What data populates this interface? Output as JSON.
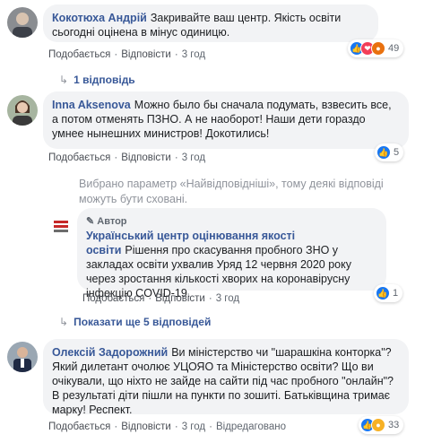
{
  "comments": [
    {
      "author": "Кокотюха Андрій",
      "text": "Закривайте ваш центр. Якість освіти сьогодні оцінена в мінус одиницю.",
      "like_label": "Подобається",
      "reply_label": "Відповісти",
      "time": "3 год",
      "reaction_count": "49",
      "replies_label": "1 відповідь"
    },
    {
      "author": "Inna Aksenova",
      "text": "Можно было бы сначала подумать, взвесить все, а потом отменять ПЗНО. А не наоборот! Наши дети гораздо умнее нынешних министров! Докотились!",
      "like_label": "Подобається",
      "reply_label": "Відповісти",
      "time": "3 год",
      "reaction_count": "5"
    },
    {
      "author": "Олексій Задорожний",
      "text": "Ви міністерство чи \"шарашкіна конторка\"? Який дилетант очолює УЦОЯО та Міністерство освіти? Що ви очікували, що ніхто не зайде на сайти під час пробного \"онлайн\"? В результаті діти пішли на пункти по зошиті. Батьківщина тримає марку! Респект.",
      "like_label": "Подобається",
      "reply_label": "Відповісти",
      "time": "3 год",
      "edited_label": "Відредаговано",
      "reaction_count": "33"
    }
  ],
  "filter_notice": "Вибрано параметр «Найвідповідніші», тому деякі відповіді можуть бути сховані.",
  "reply": {
    "badge": "Автор",
    "author": "Український центр оцінювання якості освіти",
    "text": "Рішення про скасування пробного ЗНО у закладах освіти ухвалив Уряд 12 червня 2020 року через зростання кількості хворих на коронавірусну інфекцію COVID-19.",
    "like_label": "Подобається",
    "reply_label": "Відповісти",
    "time": "3 год",
    "reaction_count": "1"
  },
  "show_more_replies": "Показати ще 5 відповідей",
  "colors": {
    "link": "#385898",
    "bubble": "#f2f3f5",
    "like": "#1877f2"
  }
}
